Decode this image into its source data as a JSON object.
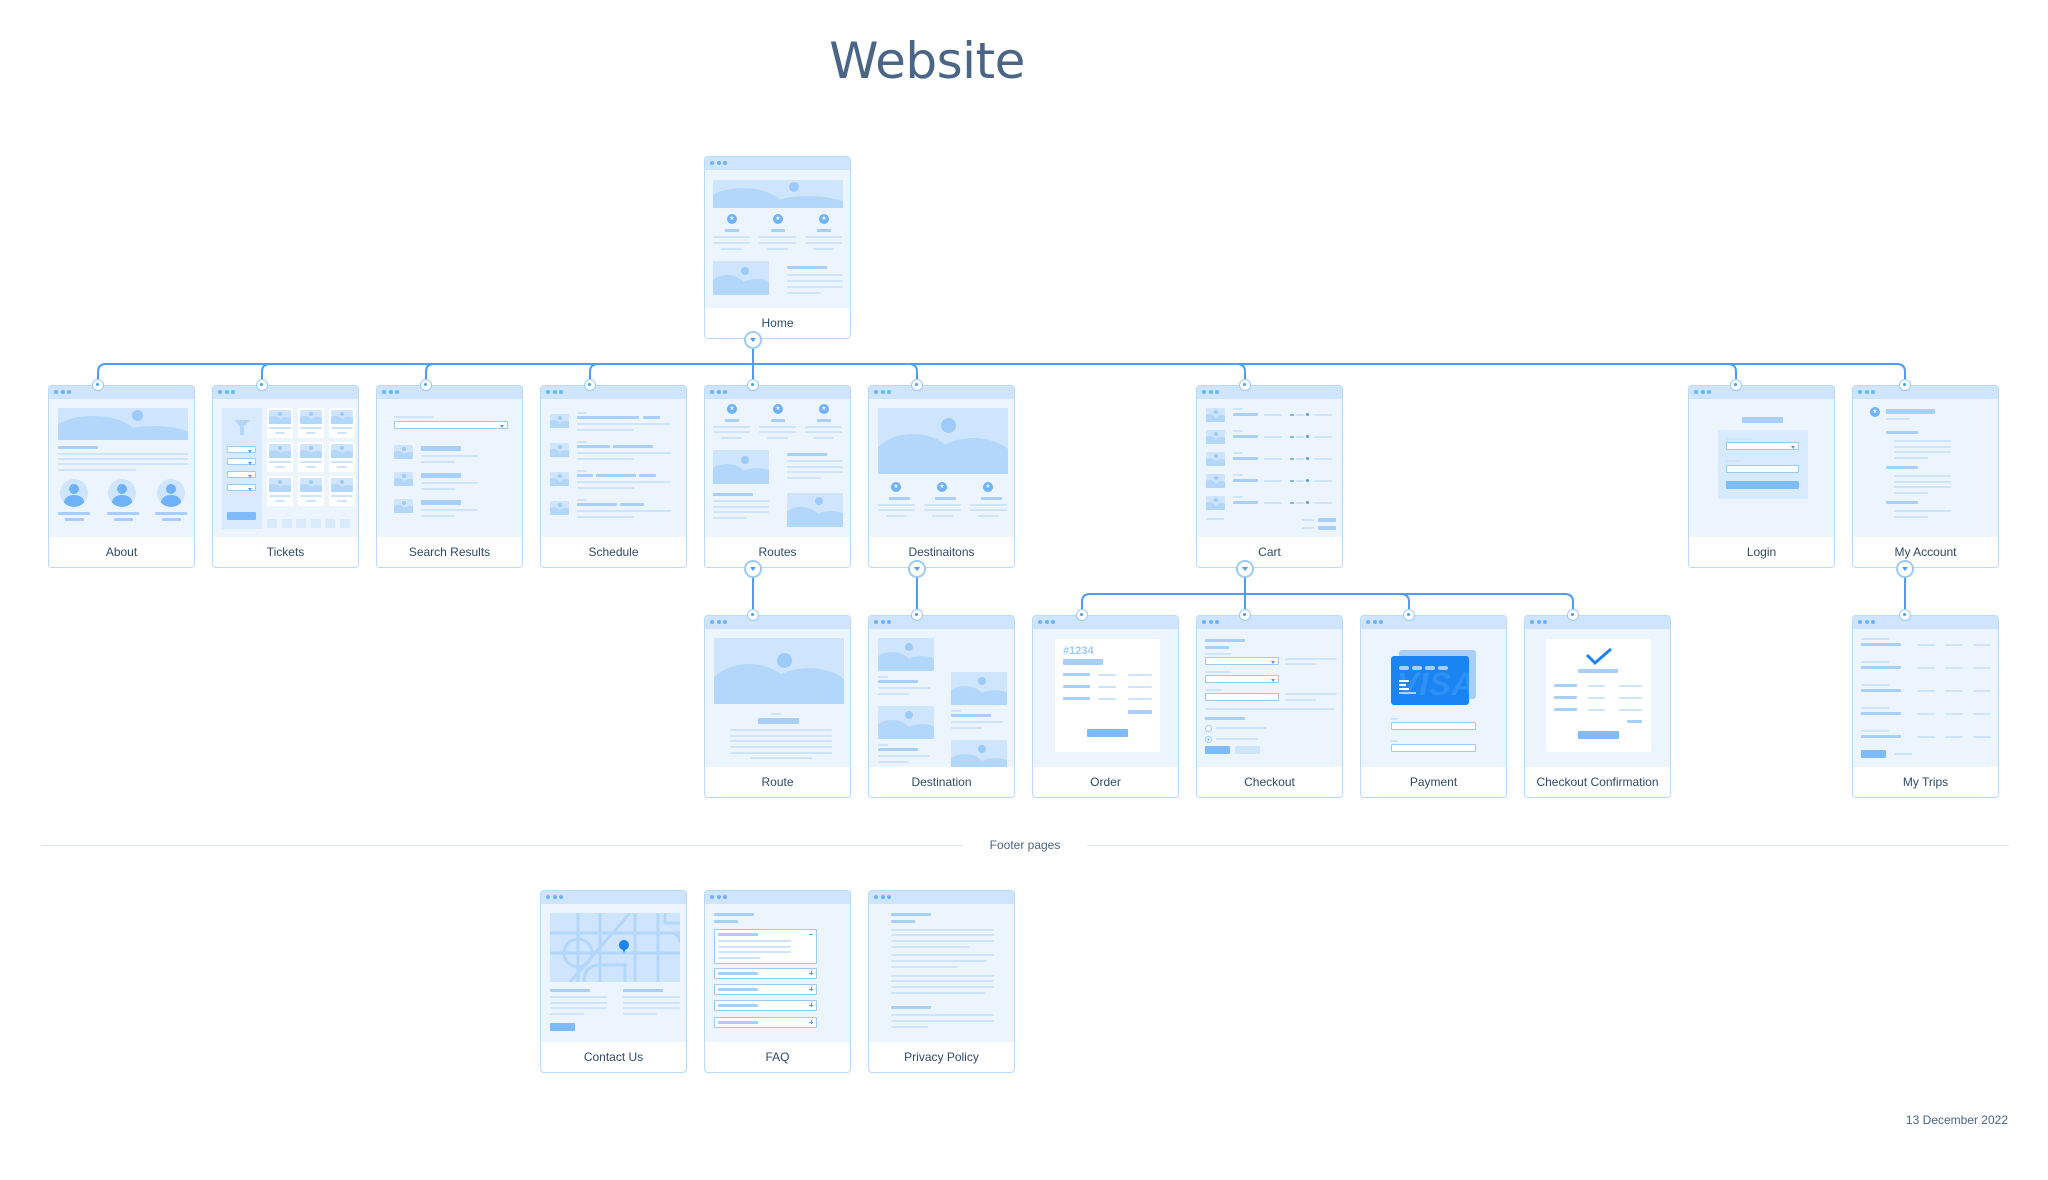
{
  "title": "Website",
  "date": "13 December 2022",
  "footer_section_label": "Footer pages",
  "order_number": "#1234",
  "card_brand_watermark": "VISA",
  "pages": {
    "home": "Home",
    "about": "About",
    "tickets": "Tickets",
    "search_results": "Search Results",
    "schedule": "Schedule",
    "routes": "Routes",
    "destinations": "Destinaitons",
    "cart": "Cart",
    "login": "Login",
    "my_account": "My Account",
    "route": "Route",
    "destination": "Destination",
    "order": "Order",
    "checkout": "Checkout",
    "payment": "Payment",
    "checkout_confirmation": "Checkout Confirmation",
    "my_trips": "My Trips",
    "contact_us": "Contact Us",
    "faq": "FAQ",
    "privacy_policy": "Privacy Policy"
  },
  "hierarchy": {
    "Home": [
      "About",
      "Tickets",
      "Search Results",
      "Schedule",
      "Routes",
      "Destinaitons",
      "Cart",
      "Login",
      "My Account"
    ],
    "Routes": [
      "Route"
    ],
    "Destinaitons": [
      "Destination"
    ],
    "Cart": [
      "Order",
      "Checkout",
      "Payment",
      "Checkout Confirmation"
    ],
    "My Account": [
      "My Trips"
    ],
    "Footer pages": [
      "Contact Us",
      "FAQ",
      "Privacy Policy"
    ]
  },
  "colors": {
    "title": "#4a6585",
    "connector": "#4d9ef2",
    "card_border": "#b9dbfb",
    "card_header": "#cfe5fd",
    "preview_bg": "#ecf5fe",
    "accent": "#1a85f2"
  }
}
